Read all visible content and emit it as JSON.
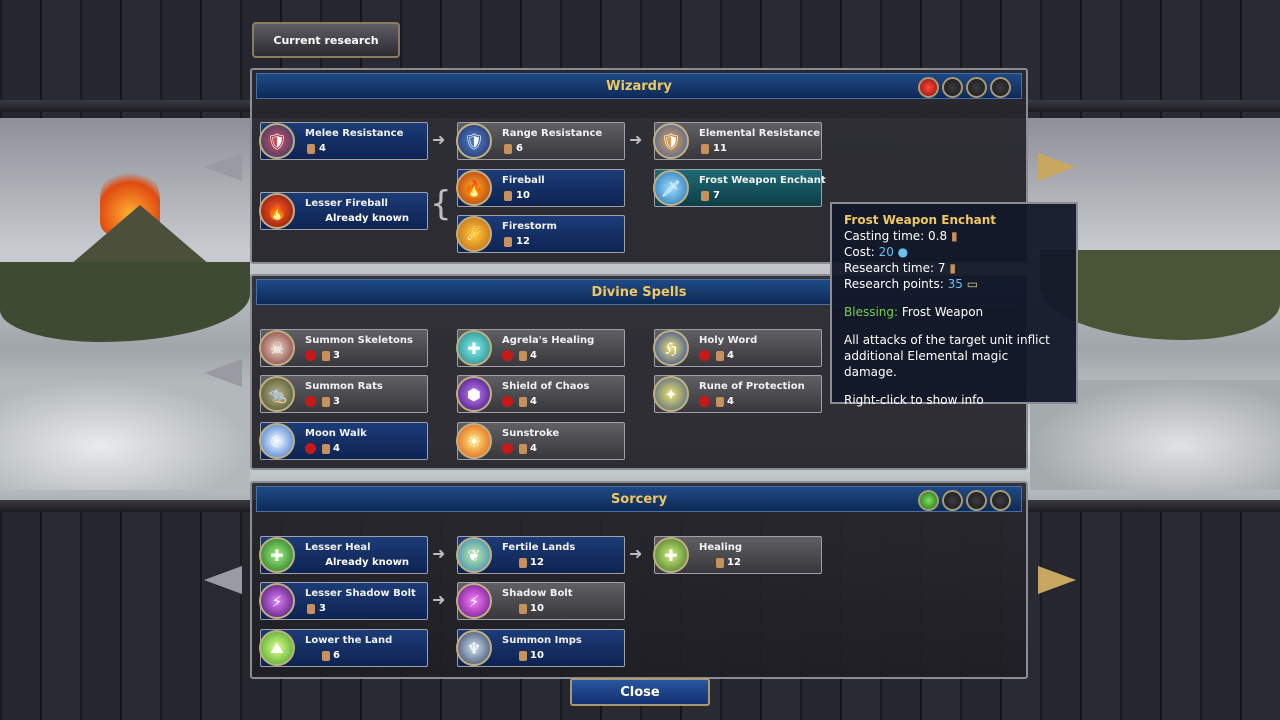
{
  "header": {
    "current_research_label": "Current research"
  },
  "panels": {
    "wizardry": {
      "title": "Wizardry"
    },
    "divine": {
      "title": "Divine Spells"
    },
    "sorcery": {
      "title": "Sorcery"
    }
  },
  "wizardry": {
    "melee_resistance": {
      "name": "Melee Resistance",
      "cost": "4"
    },
    "range_resistance": {
      "name": "Range Resistance",
      "cost": "6"
    },
    "elemental_resistance": {
      "name": "Elemental Resistance",
      "cost": "11"
    },
    "lesser_fireball": {
      "name": "Lesser Fireball",
      "status": "Already known"
    },
    "fireball": {
      "name": "Fireball",
      "cost": "10"
    },
    "frost_weapon_enchant": {
      "name": "Frost Weapon Enchant",
      "cost": "7"
    },
    "firestorm": {
      "name": "Firestorm",
      "cost": "12"
    }
  },
  "divine": {
    "summon_skeletons": {
      "name": "Summon Skeletons",
      "cost": "3"
    },
    "agrelas_healing": {
      "name": "Agrela's Healing",
      "cost": "4"
    },
    "holy_word": {
      "name": "Holy Word",
      "cost": "4"
    },
    "summon_rats": {
      "name": "Summon Rats",
      "cost": "3"
    },
    "shield_of_chaos": {
      "name": "Shield of Chaos",
      "cost": "4"
    },
    "rune_of_protection": {
      "name": "Rune of Protection",
      "cost": "4"
    },
    "moon_walk": {
      "name": "Moon Walk",
      "cost": "4"
    },
    "sunstroke": {
      "name": "Sunstroke",
      "cost": "4"
    }
  },
  "sorcery": {
    "lesser_heal": {
      "name": "Lesser Heal",
      "status": "Already known"
    },
    "fertile_lands": {
      "name": "Fertile Lands",
      "cost": "12"
    },
    "healing": {
      "name": "Healing",
      "cost": "12"
    },
    "lesser_shadow_bolt": {
      "name": "Lesser Shadow Bolt",
      "cost": "3"
    },
    "shadow_bolt": {
      "name": "Shadow Bolt",
      "cost": "10"
    },
    "lower_the_land": {
      "name": "Lower the Land",
      "cost": "6"
    },
    "summon_imps": {
      "name": "Summon Imps",
      "cost": "10"
    }
  },
  "tooltip": {
    "title": "Frost Weapon Enchant",
    "casting_time_label": "Casting time:",
    "casting_time": "0.8",
    "cost_label": "Cost:",
    "cost": "20",
    "research_time_label": "Research time:",
    "research_time": "7",
    "research_points_label": "Research points:",
    "research_points": "35",
    "type_label": "Blessing:",
    "type_value": "Frost Weapon",
    "description": "All attacks of the target unit inflict additional Elemental magic damage.",
    "hint": "Right-click to show info"
  },
  "footer": {
    "close_label": "Close"
  },
  "colors": {
    "title_gold": "#f0c860",
    "panel_blue": "#1f4a86",
    "highlight_blue": "#6ac0f0",
    "blessing_green": "#78d050"
  }
}
